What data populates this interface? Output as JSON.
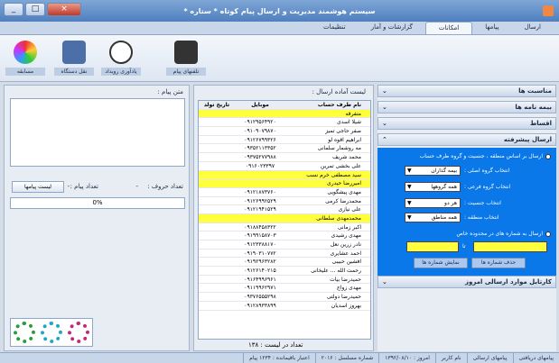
{
  "window": {
    "title": "سیستم هوشمند مدیریت و ارسال پیام کوتاه * ستاره *"
  },
  "tabs": [
    "ارسال",
    "پیامها",
    "امکانات",
    "گزارشات و آمار",
    "تنظیمات"
  ],
  "ribbon": [
    "تلفنهای پیام",
    "یادآوری رویداد",
    "نقل دستگاه",
    "مسابقه"
  ],
  "message": {
    "label": "متن پیام :",
    "chars_label": "تعداد حروف :",
    "chars_value": "-",
    "count_label": "تعداد پیام :",
    "count_value": "-",
    "send_label": "لیست پیامها",
    "progress": "0%"
  },
  "list": {
    "label": "لیست آماده ارسال :",
    "headers": [
      "نام طرف حساب",
      "موبایل",
      "تاریخ تولد"
    ],
    "rows": [
      {
        "name": "متفرقه",
        "group": true
      },
      {
        "name": "شیلا اسدی",
        "mobile": "۰۹۱۲۹۵۶۴۹۲۰"
      },
      {
        "name": "صفر حاجی تمیز",
        "mobile": "۰۹۱۰۹۰۷۹۸۷۰"
      },
      {
        "name": "ابراهیم اقوه لو",
        "mobile": "۰۹۱۲۶۷۹۹۳۲۶"
      },
      {
        "name": "مه روشمار سلمانی",
        "mobile": "۰۹۳۵۲۱۱۳۳۵۲"
      },
      {
        "name": "محمد شریف",
        "mobile": "۰۹۳۷۵۲۷۷۹۸۸"
      },
      {
        "name": "علی بخشی تمرین",
        "mobile": "۰۹۱۶۰۲۳۳۹۷"
      },
      {
        "name": "سید مصطفی خرم نسب",
        "group": true
      },
      {
        "name": "امیررضا حیدری",
        "group": true
      },
      {
        "name": "مهدی پیشگویی",
        "mobile": "۰۹۱۲۱۸۷۳۷۶۰"
      },
      {
        "name": "محمدرضا کرمی",
        "mobile": "۰۹۱۲۶۹۹۲۵۲۹"
      },
      {
        "name": "علی نیازی",
        "mobile": "۰۹۱۲۱۹۴۱۵۲۹"
      },
      {
        "name": "محمدمهدی سلطانی",
        "group": true
      },
      {
        "name": "اکبر زمانی",
        "mobile": "۰۹۱۸۸۴۵۸۳۲۲"
      },
      {
        "name": "مهدی رشیدی",
        "mobile": "۰۹۱۹۹۱۵۸۷۰۳"
      },
      {
        "name": "نادر زرین نعل",
        "mobile": "۰۹۱۲۳۳۸۸۱۷۰"
      },
      {
        "name": "احمد عشایری",
        "mobile": "۰۹۱۹۰۳۱۰۷۷۲"
      },
      {
        "name": "افشین حبیبی",
        "mobile": "۰۹۱۹۲۹۶۳۲۸۲"
      },
      {
        "name": "رحمت الله ... علیخانی",
        "mobile": "۰۹۱۲۶۱۴۰۲۱۵"
      },
      {
        "name": "حمیدرضا بیات",
        "mobile": "۰۹۱۶۴۹۹۶۹۶۱"
      },
      {
        "name": "مهدی زواج",
        "mobile": "۰۹۱۱۹۹۶۲۹۷۱"
      },
      {
        "name": "حمیدرضا دولتی",
        "mobile": "۰۹۳۷۶۵۵۵۲۹۸"
      },
      {
        "name": "بهروز اسدیان",
        "mobile": "۰۹۱۲۸۹۳۳۸۹۹"
      }
    ],
    "count_label": "تعداد در لیست :",
    "count_value": "۱۳۸"
  },
  "accordion": [
    "مناسبت ها",
    "بیمه نامه ها",
    "اقساط",
    "ارسال پیشرفته",
    "کارتابل موارد ارسالی امروز"
  ],
  "advanced": {
    "radio1": "ارسال بر اساس منطقه ، جنسیت و گروه طرف حساب",
    "fields": [
      {
        "label": "انتخاب گروه اصلی :",
        "value": "بیمه گذاران"
      },
      {
        "label": "انتخاب گروه فرعی :",
        "value": "همه گروهها"
      },
      {
        "label": "انتخاب جنسیت :",
        "value": "هر دو"
      },
      {
        "label": "انتخاب منطقه :",
        "value": "همه مناطق"
      }
    ],
    "radio2": "ارسال به شماره های در محدوده خاص",
    "to_label": "تا",
    "btn_show": "نمایش شماره ها",
    "btn_delete": "حذف شماره ها"
  },
  "status": [
    "پیامهای دریافتی",
    "پیامهای ارسالی",
    "نام کاربر",
    "امروز : ۱۳۹۲/۰۸/۱۰",
    "شماره مسلسل : ۲۰۱۶",
    "اعتبار باقیمانده : ۱۲۳۴ پیام"
  ],
  "colors": {
    "accent": "#0a78e8",
    "highlight": "#ffff3c"
  }
}
